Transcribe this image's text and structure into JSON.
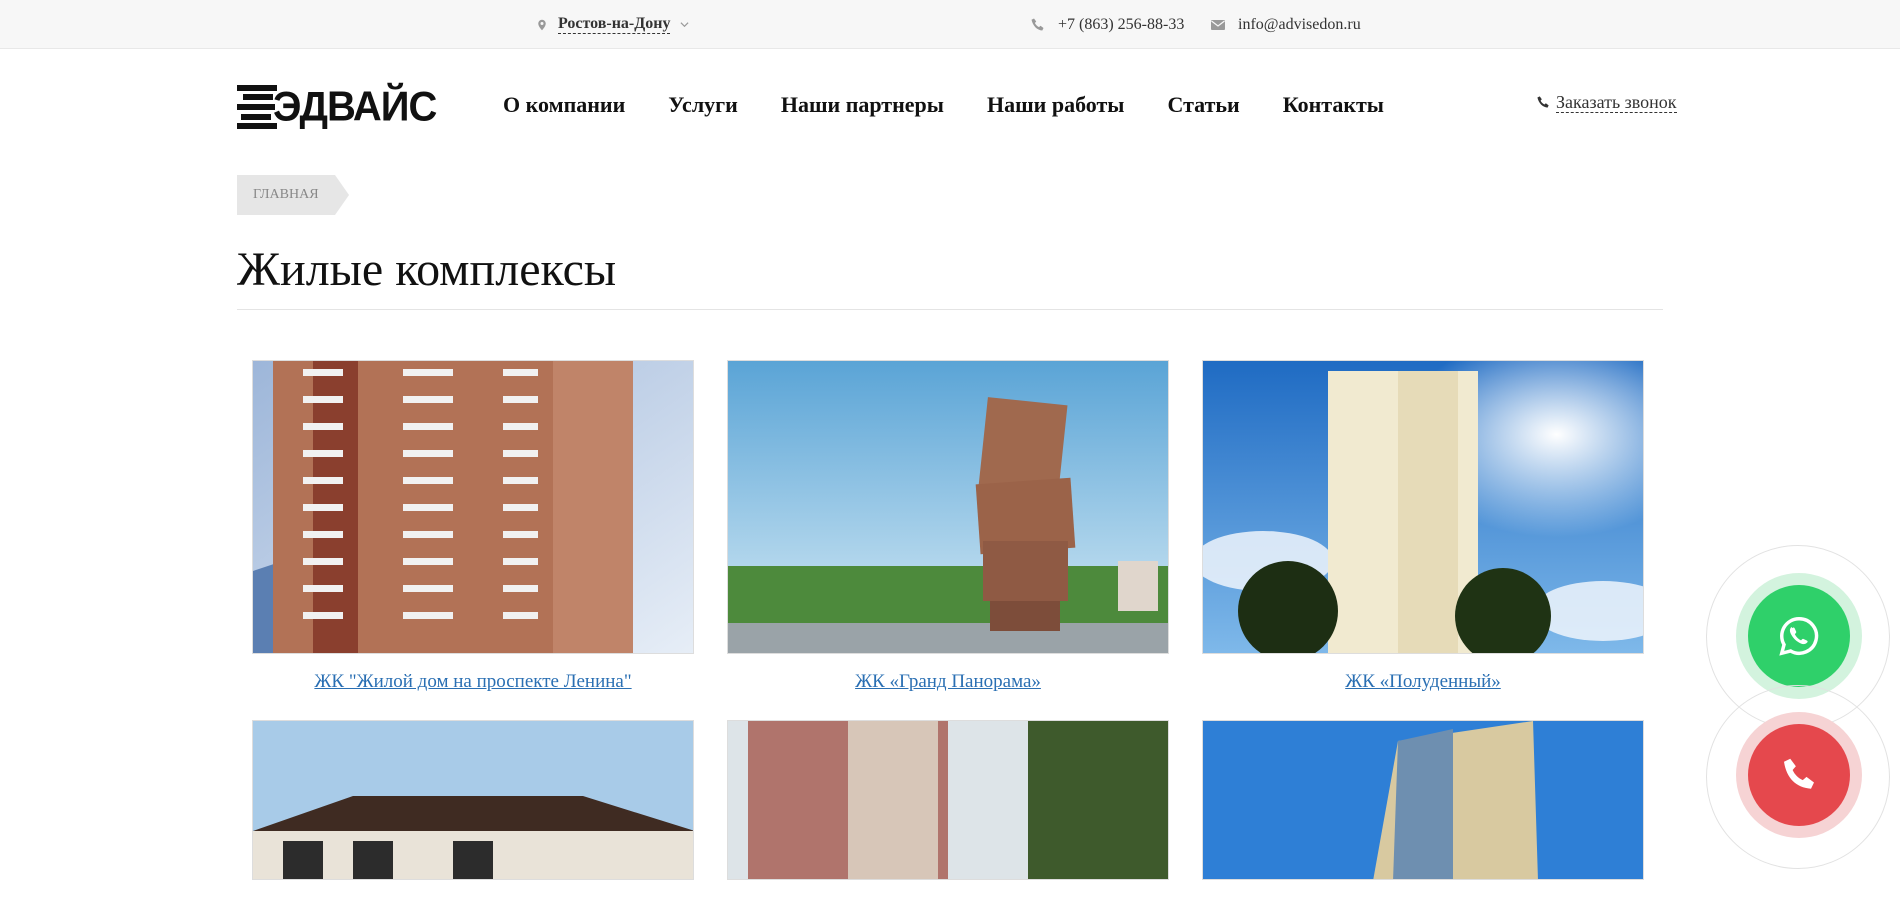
{
  "topbar": {
    "city": "Ростов-на-Дону",
    "phone": "+7 (863) 256-88-33",
    "email": "info@advisedon.ru"
  },
  "header": {
    "logo_text": "ЭДВАЙС",
    "nav": [
      "О компании",
      "Услуги",
      "Наши партнеры",
      "Наши работы",
      "Статьи",
      "Контакты"
    ],
    "callback": "Заказать звонок"
  },
  "breadcrumb": [
    "Главная"
  ],
  "page": {
    "title": "Жилые комплексы"
  },
  "cards": [
    {
      "caption": "ЖК \"Жилой дом на проспекте Ленина\""
    },
    {
      "caption": "ЖК «Гранд Панорама»"
    },
    {
      "caption": "ЖК «Полуденный»"
    },
    {
      "caption": ""
    },
    {
      "caption": ""
    },
    {
      "caption": ""
    }
  ],
  "colors": {
    "link": "#2a6fb3",
    "whatsapp": "#2fd06a",
    "call": "#e5484d"
  },
  "icons": {
    "city": "map-pin-icon",
    "phone": "phone-icon",
    "email": "envelope-icon",
    "whatsapp": "whatsapp-icon",
    "call": "phone-handset-icon"
  }
}
